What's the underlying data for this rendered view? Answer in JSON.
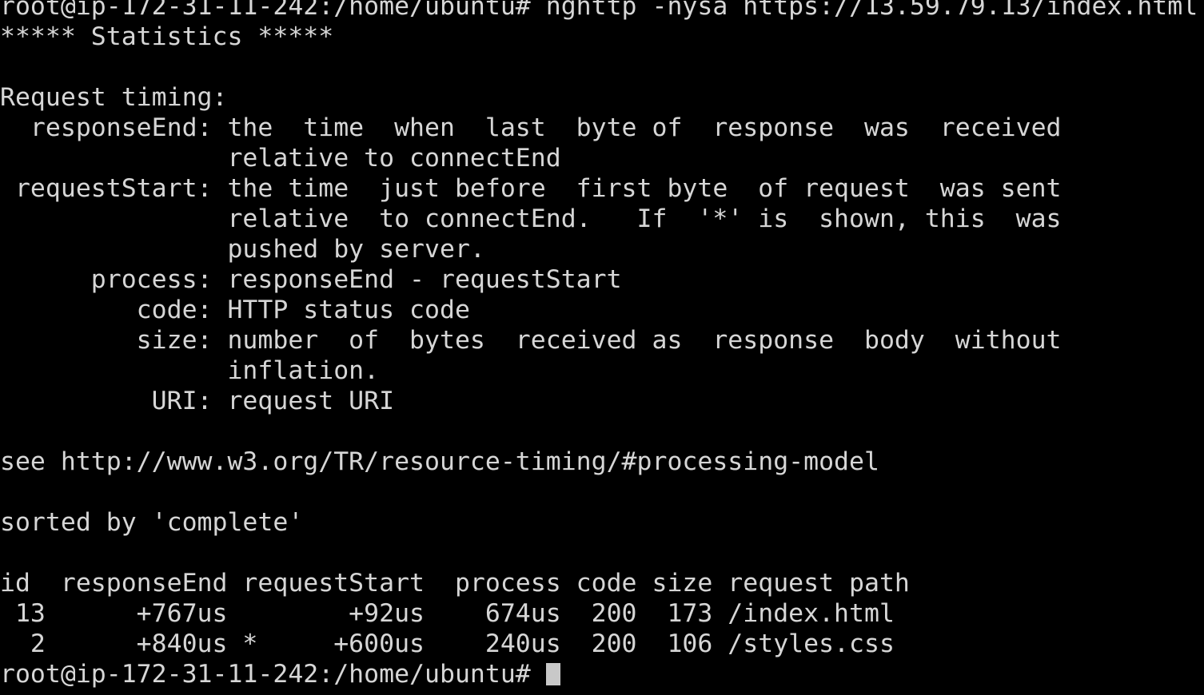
{
  "colors": {
    "background": "#000000",
    "foreground": "#d6d6d6",
    "cursor": "#c8c8c8"
  },
  "terminal": {
    "lines": [
      "root@ip-172-31-11-242:/home/ubuntu# nghttp -nysa https://13.59.79.13/index.html",
      "***** Statistics *****",
      "",
      "Request timing:",
      "  responseEnd: the  time  when  last  byte of  response  was  received",
      "               relative to connectEnd",
      " requestStart: the time  just before  first byte  of request  was sent",
      "               relative  to connectEnd.   If  '*' is  shown, this  was",
      "               pushed by server.",
      "      process: responseEnd - requestStart",
      "         code: HTTP status code",
      "         size: number  of  bytes  received as  response  body  without",
      "               inflation.",
      "          URI: request URI",
      "",
      "see http://www.w3.org/TR/resource-timing/#processing-model",
      "",
      "sorted by 'complete'",
      "",
      "id  responseEnd requestStart  process code size request path",
      " 13      +767us        +92us    674us  200  173 /index.html",
      "  2      +840us *     +600us    240us  200  106 /styles.css"
    ],
    "prompt": "root@ip-172-31-11-242:/home/ubuntu# "
  }
}
